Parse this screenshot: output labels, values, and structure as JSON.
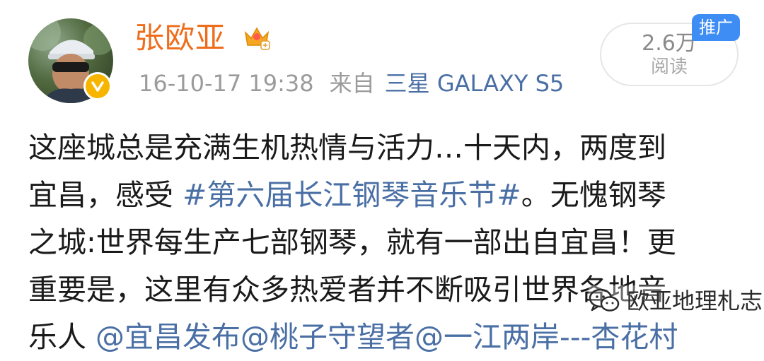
{
  "post": {
    "author": "张欧亚",
    "time": "16-10-17 19:38",
    "from_label": "来自",
    "device": "三星 GALAXY S5",
    "read_count": "2.6万",
    "read_label": "阅读",
    "promo_badge": "推广",
    "body": {
      "line1": "这座城总是充满生机热情与活力…十天内，两度到",
      "line2_a": "宜昌，感受 ",
      "line2_topic": "#第六届长江钢琴音乐节#",
      "line2_b": "。无愧钢琴",
      "line3": "之城:世界每生产七部钢琴，就有一部出自宜昌！更",
      "line4": "重要是，这里有众多热爱者并不断吸引世界各地音",
      "line5_a": "乐人 ",
      "line5_mentions": "@宜昌发布@桃子守望者@一江两岸---杏花村"
    }
  },
  "watermark": {
    "text": "欧亚地理札志",
    "icon": "wechat-icon"
  },
  "icons": {
    "avatar": "avatar",
    "verified": "verified-v-icon",
    "member": "crown-member-icon"
  },
  "colors": {
    "username": "#ee6d1b",
    "link": "#4a6fa5",
    "meta": "#9b9b9b",
    "promo": "#3d8df5",
    "verified": "#f7b500"
  }
}
